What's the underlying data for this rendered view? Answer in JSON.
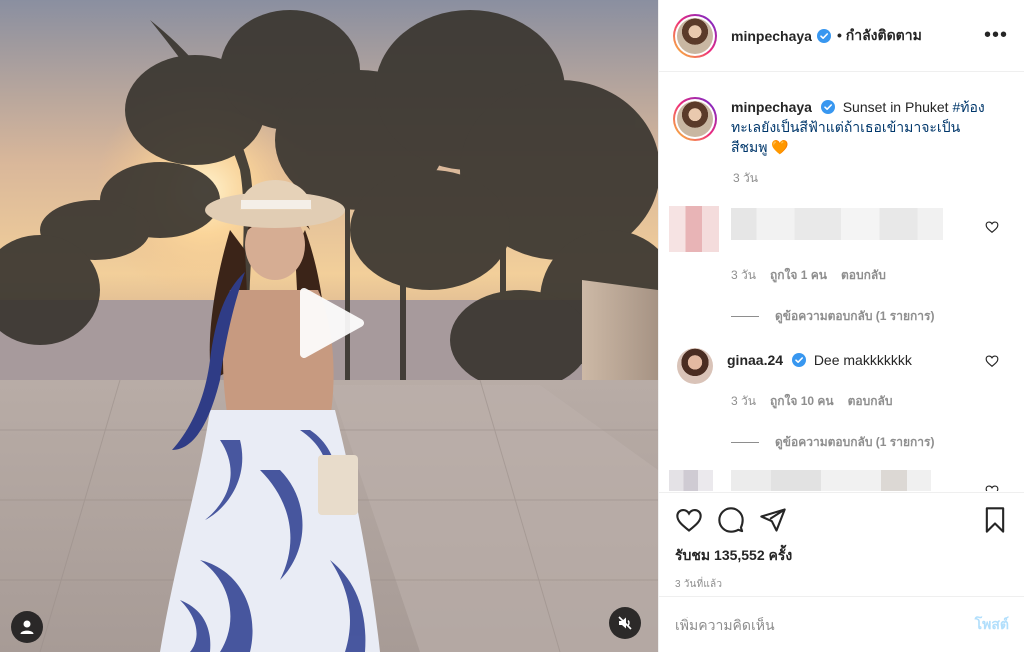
{
  "header": {
    "username": "minpechaya",
    "following_label": "• กำลังติดตาม",
    "more_label": "•••"
  },
  "caption": {
    "username": "minpechaya",
    "text": "Sunset in Phuket",
    "hashtag": "#ท้องทะเลยังเป็นสีฟ้าแต่ถ้าเธอเข้ามาจะเป็นสีชมพู",
    "emoji": "🧡",
    "time": "3 วัน"
  },
  "comments": [
    {
      "username": "",
      "text": "",
      "time": "3 วัน",
      "likes": "ถูกใจ 1 คน",
      "reply_label": "ตอบกลับ",
      "view_replies": "ดูข้อความตอบกลับ (1 รายการ)"
    },
    {
      "username": "ginaa.24",
      "text": "Dee makkkkkkk",
      "time": "3 วัน",
      "likes": "ถูกใจ 10 คน",
      "reply_label": "ตอบกลับ",
      "view_replies": "ดูข้อความตอบกลับ (1 รายการ)"
    }
  ],
  "stats": {
    "views": "รับชม 135,552 ครั้ง",
    "posted_ago": "3 วันที่แล้ว"
  },
  "add_comment": {
    "placeholder": "เพิ่มความคิดเห็น",
    "post_label": "โพสต์"
  },
  "colors": {
    "verified_blue": "#3897f0",
    "link_blue": "#00376b",
    "muted_text": "#8e8e8e",
    "post_button": "#b2dffc"
  }
}
